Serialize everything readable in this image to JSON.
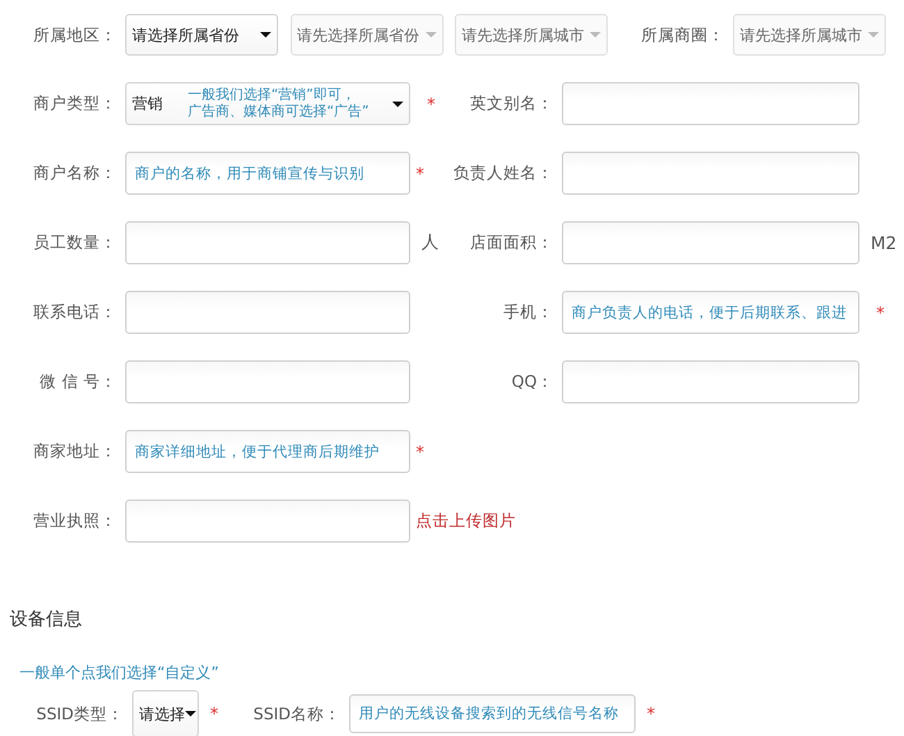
{
  "region": {
    "label": "所属地区：",
    "selects": [
      {
        "value": "请选择所属省份",
        "disabled": false
      },
      {
        "value": "请先选择所属省份",
        "disabled": true
      },
      {
        "value": "请先选择所属城市",
        "disabled": true
      }
    ]
  },
  "district": {
    "label": "所属商圈：",
    "select": {
      "value": "请先选择所属城市",
      "disabled": true
    }
  },
  "rows": [
    {
      "left": {
        "label": "商户类型：",
        "kind": "select",
        "value": "营销",
        "disabled": false,
        "hint": [
          "一般我们选择“营销”即可，",
          "广告商、媒体商可选择“广告”"
        ],
        "mark": "*"
      },
      "right": {
        "label": "英文别名：",
        "kind": "input"
      }
    },
    {
      "left": {
        "label": "商户名称：",
        "kind": "input",
        "placeholder": "商户的名称，用于商铺宣传与识别",
        "mark": "*"
      },
      "right": {
        "label": "负责人姓名：",
        "kind": "input"
      }
    },
    {
      "left": {
        "label": "员工数量：",
        "kind": "input",
        "unit": "人"
      },
      "right": {
        "label": "店面面积：",
        "kind": "input",
        "unit": "M2"
      }
    },
    {
      "left": {
        "label": "联系电话：",
        "kind": "input"
      },
      "right": {
        "label": "手机：",
        "kind": "input",
        "placeholder": "商户负责人的电话，便于后期联系、跟进",
        "mark": "*"
      }
    },
    {
      "left": {
        "label": "微 信 号：",
        "kind": "input"
      },
      "right": {
        "label": "QQ：",
        "kind": "input"
      }
    },
    {
      "left": {
        "label": "商家地址：",
        "kind": "input",
        "placeholder": "商家详细地址，便于代理商后期维护",
        "mark": "*"
      }
    },
    {
      "left": {
        "label": "营业执照：",
        "kind": "input",
        "link": "点击上传图片"
      }
    }
  ],
  "device": {
    "title": "设备信息",
    "hint": "一般单个点我们选择“自定义”",
    "ssid_type": {
      "label": "SSID类型：",
      "value": "请选择",
      "disabled": false,
      "mark": "*"
    },
    "ssid_name": {
      "label": "SSID名称：",
      "placeholder": "用户的无线设备搜索到的无线信号名称",
      "mark": "*"
    }
  }
}
